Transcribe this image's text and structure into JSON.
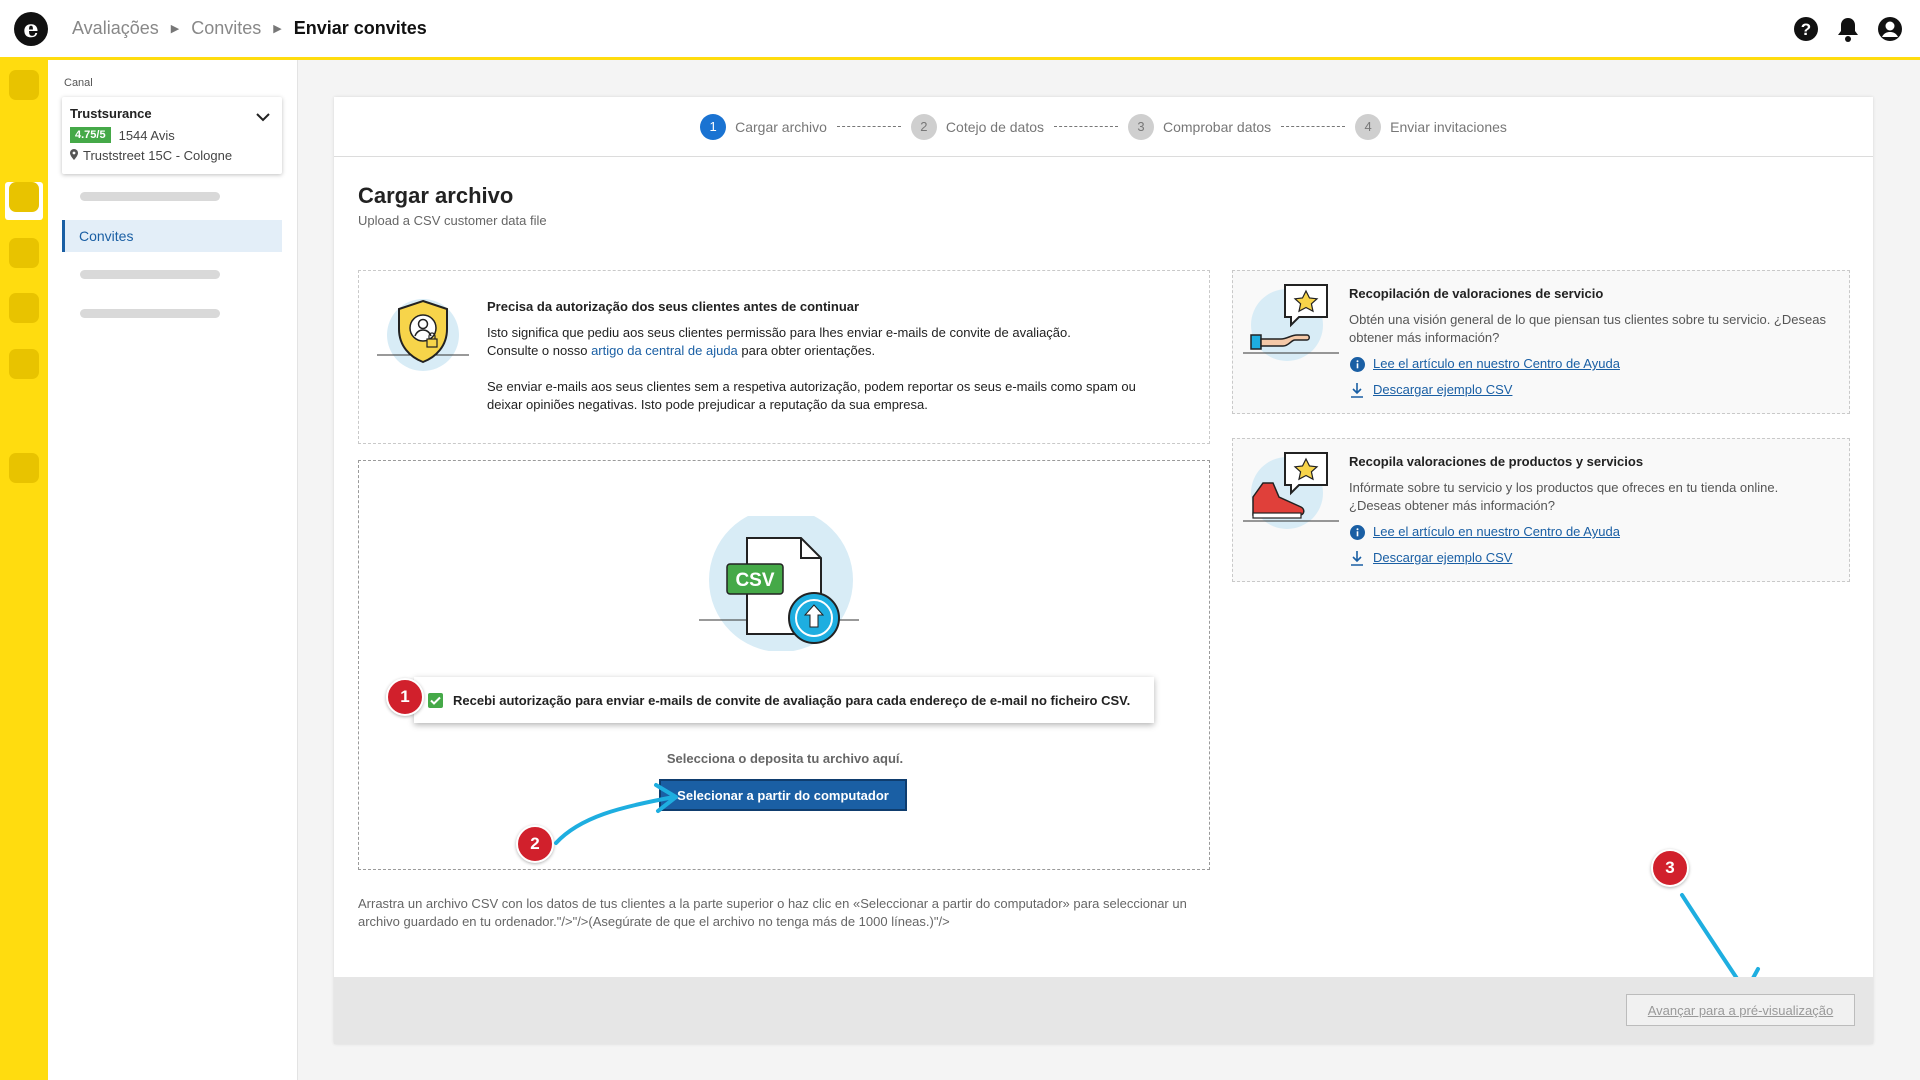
{
  "header": {
    "logo_letter": "e",
    "breadcrumbs": [
      "Avaliações",
      "Convites",
      "Enviar convites"
    ]
  },
  "sidebar": {
    "channel_label": "Canal",
    "channel": {
      "name": "Trustsurance",
      "rating": "4.75/5",
      "reviews": "1544 Avis",
      "address": "Truststreet 15C - Cologne"
    },
    "active_item": "Convites"
  },
  "stepper": [
    {
      "num": "1",
      "label": "Cargar archivo"
    },
    {
      "num": "2",
      "label": "Cotejo de datos"
    },
    {
      "num": "3",
      "label": "Comprobar datos"
    },
    {
      "num": "4",
      "label": "Enviar invitaciones"
    }
  ],
  "page": {
    "title": "Cargar archivo",
    "subtitle": "Upload a CSV customer data file"
  },
  "auth": {
    "title": "Precisa da autorização dos seus clientes antes de continuar",
    "line1": "Isto significa que pediu aos seus clientes permissão para lhes enviar e-mails de convite de avaliação.",
    "line2_pre": "Consulte o nosso",
    "line2_link": "artigo da central de ajuda",
    "line2_post": "para obter orientações.",
    "para2": "Se enviar e-mails aos seus clientes sem a respetiva autorização, podem reportar os seus e-mails como spam ou deixar opiniões negativas. Isto pode prejudicar a reputação da sua empresa."
  },
  "upload": {
    "csv_label": "CSV",
    "consent": "Recebi autorização para enviar e-mails de convite de avaliação para cada endereço de e-mail no ficheiro CSV.",
    "consent_checked": true,
    "hint": "Selecciona o deposita tu archivo aquí.",
    "button": "Selecionar a partir do computador"
  },
  "markers": [
    "1",
    "2",
    "3"
  ],
  "foot_note": "Arrastra un archivo CSV con los datos de tus clientes a la parte superior o haz clic en «Seleccionar a partir do computador» para seleccionar un archivo guardado en tu ordenador.\"/>\"/>(Asegúrate de que el archivo no tenga más de 1000 líneas.)\"/>",
  "cards": [
    {
      "title": "Recopilación de valoraciones de servicio",
      "desc": "Obtén una visión general de lo que piensan tus clientes sobre tu servicio. ¿Deseas obtener más información?",
      "help_link": "Lee el artículo en nuestro Centro de Ayuda",
      "download_link": "Descargar ejemplo CSV"
    },
    {
      "title": "Recopila valoraciones de productos y servicios",
      "desc": "Infórmate sobre tu servicio y los productos que ofreces en tu tienda online. ¿Deseas obtener más información?",
      "help_link": "Lee el artículo en nuestro Centro de Ayuda",
      "download_link": "Descargar ejemplo CSV"
    }
  ],
  "footer": {
    "next_button": "Avançar para a pré-visualização"
  },
  "colors": {
    "brand_yellow": "#ffdc0f",
    "primary_blue": "#1a5fa4",
    "step_active": "#1a73d2",
    "success_green": "#45a948",
    "marker_red": "#d1202c",
    "arrow_cyan": "#1eaee0"
  }
}
